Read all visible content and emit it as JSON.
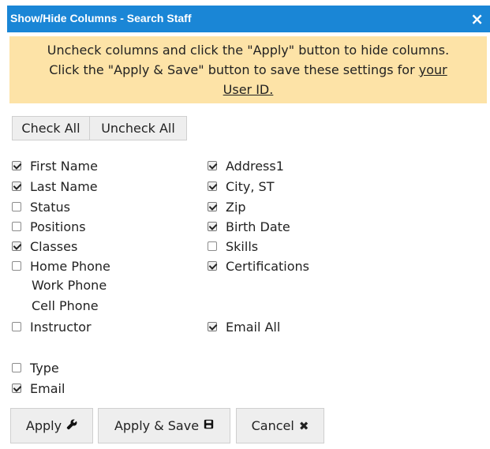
{
  "dialog": {
    "title": "Show/Hide Columns - Search Staff",
    "close_icon": "×",
    "notice_line1": "Uncheck columns and click the \"Apply\" button to hide columns.",
    "notice_line2_prefix": "Click the \"Apply & Save\" button to save these settings for ",
    "notice_link_part1": "your",
    "notice_link_part2": " User ID."
  },
  "toolbar": {
    "check_all": "Check All",
    "uncheck_all": "Uncheck All"
  },
  "columns": {
    "first_name": {
      "label": "First Name",
      "checked": true
    },
    "last_name": {
      "label": "Last Name",
      "checked": true
    },
    "status": {
      "label": "Status",
      "checked": false
    },
    "positions": {
      "label": "Positions",
      "checked": false
    },
    "classes": {
      "label": "Classes",
      "checked": true
    },
    "home_phone": {
      "label": "Home Phone",
      "checked": false
    },
    "work_phone": {
      "label": "Work Phone"
    },
    "cell_phone": {
      "label": "Cell Phone"
    },
    "instructor": {
      "label": "Instructor",
      "checked": false
    },
    "type": {
      "label": "Type",
      "checked": false
    },
    "email": {
      "label": "Email",
      "checked": true
    },
    "address1": {
      "label": "Address1",
      "checked": true
    },
    "city_st": {
      "label": "City, ST",
      "checked": true
    },
    "zip": {
      "label": "Zip",
      "checked": true
    },
    "birth_date": {
      "label": "Birth Date",
      "checked": true
    },
    "skills": {
      "label": "Skills",
      "checked": false
    },
    "certifications": {
      "label": "Certifications",
      "checked": true
    },
    "email_all": {
      "label": "Email All",
      "checked": true
    }
  },
  "footer": {
    "apply": "Apply",
    "apply_icon": "wrench-icon",
    "apply_save": "Apply & Save",
    "apply_save_icon": "floppy-disk-icon",
    "cancel": "Cancel",
    "cancel_icon": "close-icon"
  },
  "colors": {
    "titlebar": "#1a86d6",
    "notice_bg": "#fde3a7"
  }
}
